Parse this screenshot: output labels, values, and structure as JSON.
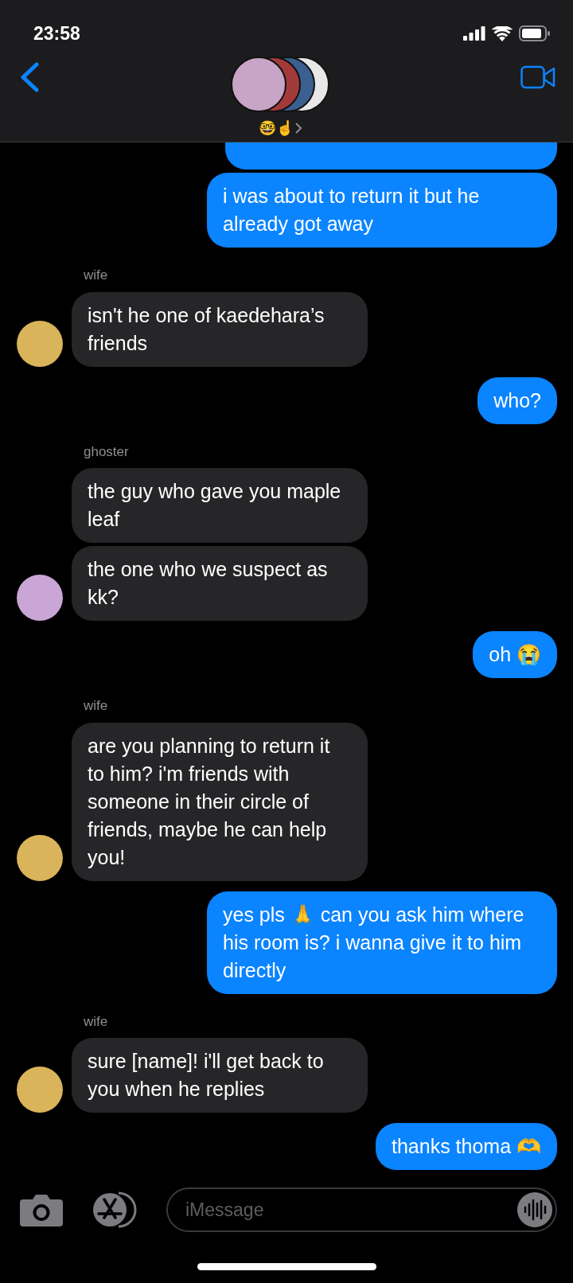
{
  "status_bar": {
    "time": "23:58"
  },
  "header": {
    "title": "🤓☝️",
    "group_avatars": [
      {
        "color": "#c8a4c6"
      },
      {
        "color": "#a33a3a"
      },
      {
        "color": "#3b5f8f"
      },
      {
        "color": "#e8e8e8"
      }
    ]
  },
  "messages": [
    {
      "kind": "outgoing"
    },
    {
      "kind": "outgoing",
      "text": "i was about to return it but he already got away"
    },
    {
      "kind": "incoming",
      "sender": "wife",
      "text": "isn't he one of kaedehara’s friends",
      "color": "#d9b45a"
    },
    {
      "kind": "outgoing",
      "text": "who?"
    },
    {
      "kind": "incoming",
      "sender": "ghoster",
      "text": "the guy who gave you maple leaf"
    },
    {
      "kind": "incoming",
      "text": "the one who we suspect as kk?",
      "color": "#c9a6d6"
    },
    {
      "kind": "outgoing",
      "text": "oh 😭"
    },
    {
      "kind": "incoming",
      "sender": "wife",
      "text": "are you planning to return it to him? i'm friends with someone in their circle of friends, maybe he can help you!",
      "color": "#d9b45a"
    },
    {
      "kind": "outgoing",
      "text": "yes pls 🙏 can you ask him where his room is? i wanna give it to him directly"
    },
    {
      "kind": "incoming",
      "sender": "wife",
      "text": "sure [name]! i'll get back to you when he replies",
      "color": "#d9b45a"
    },
    {
      "kind": "outgoing",
      "text": "thanks thoma 🫶"
    }
  ],
  "composer": {
    "placeholder": "iMessage"
  }
}
